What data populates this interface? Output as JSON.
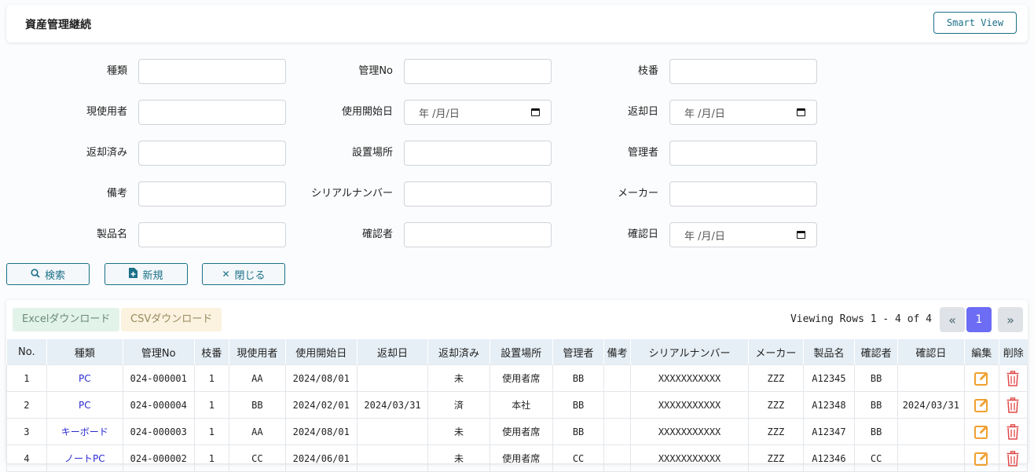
{
  "header": {
    "title": "資産管理継続",
    "smart_view": "Smart View"
  },
  "form": {
    "rows": [
      {
        "f": [
          {
            "label": "種類",
            "type": "text"
          },
          {
            "label": "管理No",
            "type": "text"
          },
          {
            "label": "枝番",
            "type": "text"
          }
        ]
      },
      {
        "f": [
          {
            "label": "現使用者",
            "type": "text"
          },
          {
            "label": "使用開始日",
            "type": "date",
            "placeholder": "年 /月/日"
          },
          {
            "label": "返却日",
            "type": "date",
            "placeholder": "年 /月/日"
          }
        ]
      },
      {
        "f": [
          {
            "label": "返却済み",
            "type": "text"
          },
          {
            "label": "設置場所",
            "type": "text"
          },
          {
            "label": "管理者",
            "type": "text"
          }
        ]
      },
      {
        "f": [
          {
            "label": "備考",
            "type": "text"
          },
          {
            "label": "シリアルナンバー",
            "type": "text"
          },
          {
            "label": "メーカー",
            "type": "text"
          }
        ]
      },
      {
        "f": [
          {
            "label": "製品名",
            "type": "text"
          },
          {
            "label": "確認者",
            "type": "text"
          },
          {
            "label": "確認日",
            "type": "date",
            "placeholder": "年 /月/日"
          }
        ]
      }
    ]
  },
  "actions": {
    "search": "検索",
    "new": "新規",
    "close": "閉じる"
  },
  "table_panel": {
    "excel": "Excelダウンロード",
    "csv": "CSVダウンロード",
    "viewing": "Viewing Rows 1 - 4 of 4",
    "page_prev": "«",
    "page_current": "1",
    "page_next": "»",
    "columns": [
      "No.",
      "種類",
      "管理No",
      "枝番",
      "現使用者",
      "使用開始日",
      "返却日",
      "返却済み",
      "設置場所",
      "管理者",
      "備考",
      "シリアルナンバー",
      "メーカー",
      "製品名",
      "確認者",
      "確認日",
      "編集",
      "削除"
    ],
    "rows": [
      [
        "1",
        "PC",
        "024-000001",
        "1",
        "AA",
        "2024/08/01",
        "",
        "未",
        "使用者席",
        "BB",
        "",
        "XXXXXXXXXXX",
        "ZZZ",
        "A12345",
        "BB",
        ""
      ],
      [
        "2",
        "PC",
        "024-000004",
        "1",
        "BB",
        "2024/02/01",
        "2024/03/31",
        "済",
        "本社",
        "BB",
        "",
        "XXXXXXXXXXX",
        "ZZZ",
        "A12348",
        "BB",
        "2024/03/31"
      ],
      [
        "3",
        "キーボード",
        "024-000003",
        "1",
        "AA",
        "2024/08/01",
        "",
        "未",
        "使用者席",
        "BB",
        "",
        "XXXXXXXXXXX",
        "ZZZ",
        "A12347",
        "BB",
        ""
      ],
      [
        "4",
        "ノートPC",
        "024-000002",
        "1",
        "CC",
        "2024/06/01",
        "",
        "未",
        "使用者席",
        "CC",
        "",
        "XXXXXXXXXXX",
        "ZZZ",
        "A12346",
        "CC",
        ""
      ]
    ]
  },
  "colors": {
    "accent": "#1b7088",
    "link": "#2a2ad0",
    "edit": "#f0a030",
    "delete": "#e04848",
    "page_active": "#6c6cf5"
  }
}
